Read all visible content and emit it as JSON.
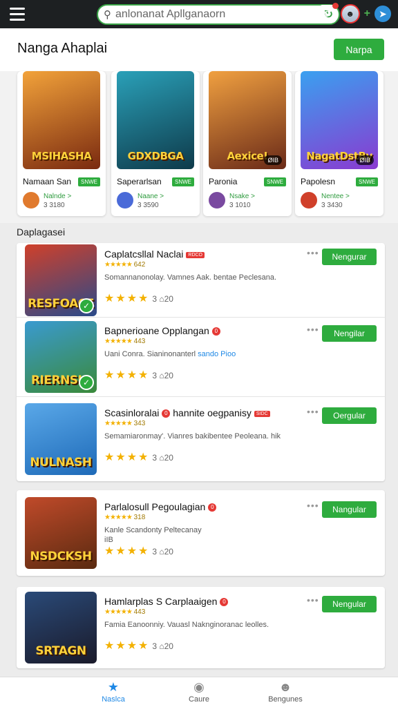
{
  "topbar": {
    "search_placeholder": "anlonanat Apllganaorn",
    "search_icon": "search-icon",
    "refresh_icon": "refresh-icon",
    "notification_count": "0"
  },
  "header": {
    "title": "Nanga Ahaplai",
    "button_label": "Narpa"
  },
  "featured": [
    {
      "art_title": "MSIHASHA",
      "name": "Namaan San",
      "tag": "SNWE",
      "sub": "Nalnde >",
      "count": "3 3180",
      "colors": [
        "#f2a23a",
        "#7a2a10"
      ],
      "dev_color": "#e07a2e"
    },
    {
      "art_title": "GDXDBGA",
      "name": "Saperarlsan",
      "tag": "SNWE",
      "sub": "Naane >",
      "count": "3 3590",
      "colors": [
        "#2aa0b8",
        "#0e3a4a"
      ],
      "dev_color": "#4a6ad8"
    },
    {
      "art_title": "Aexice!",
      "name": "Paronia",
      "tag": "SNWE",
      "sub": "Nsake >",
      "count": "3 1010",
      "colors": [
        "#f0a040",
        "#6a2a18"
      ],
      "dev_color": "#7a4aa0",
      "badge": "ØIB"
    },
    {
      "art_title": "NagatDstBy",
      "name": "Papolesn",
      "tag": "SNWE",
      "sub": "Nentee >",
      "count": "3 3430",
      "colors": [
        "#3aa0f0",
        "#8a3ad0"
      ],
      "dev_color": "#d0402a",
      "badge": "ØIB"
    }
  ],
  "section_title": "Daplagasei",
  "rows": [
    {
      "thumb_title": "RESFOACE",
      "title": "Caplatcsllal Naclai",
      "badge": "RDCO",
      "rating": "642",
      "desc": "Somannanonolay. Vamnes Aak. bentae Peclesana.",
      "stars": "3 ⌂20",
      "button": "Nengurar",
      "colors": [
        "#d0402a",
        "#2a4a8a"
      ]
    },
    {
      "thumb_title": "RIERNSIA",
      "title": "Bapnerioane Opplangan",
      "dot": "0",
      "rating": "443",
      "desc": "Uani Conra. Sianinonanterl",
      "desc_link": "sando Pioo",
      "stars": "3 ⌂20",
      "button": "Nengilar",
      "colors": [
        "#3a9ad0",
        "#3a8a3a"
      ]
    },
    {
      "thumb_title": "NULNASH",
      "title": "Scasinloralai",
      "dot": "0",
      "title_tail": "hannite oegpanisy",
      "badge": "SIDC",
      "rating": "343",
      "desc": "Semamiaronmay'. Vianres bakibentee Peoleana. hik",
      "stars": "3 ⌂20",
      "button": "Oergular",
      "colors": [
        "#5aa8e8",
        "#1e6ab8"
      ]
    },
    {
      "thumb_title": "NSDCKSH",
      "title": "Parlalosull Pegoulagian",
      "dot": "0",
      "rating": "318",
      "desc": "Kanle Scandonty Peltecanay",
      "desc2": "iIB",
      "stars": "3 ⌂20",
      "button": "Nangular",
      "colors": [
        "#c04a2a",
        "#5a2a10"
      ]
    },
    {
      "thumb_title": "SRTAGN",
      "title": "Hamlarplas S Carplaaigen",
      "dot": "0",
      "rating": "443",
      "desc": "Famia Eanoonniy. Vauasl Naknginoranac leolles.",
      "stars": "3 ⌂20",
      "button": "Nengular",
      "colors": [
        "#2a4a78",
        "#1a1a2a"
      ]
    }
  ],
  "nav": {
    "home": "Naslca",
    "center": "Caure",
    "right": "Bengunes"
  },
  "colors": {
    "accent": "#2eac3e",
    "topbar": "#1d2022"
  }
}
